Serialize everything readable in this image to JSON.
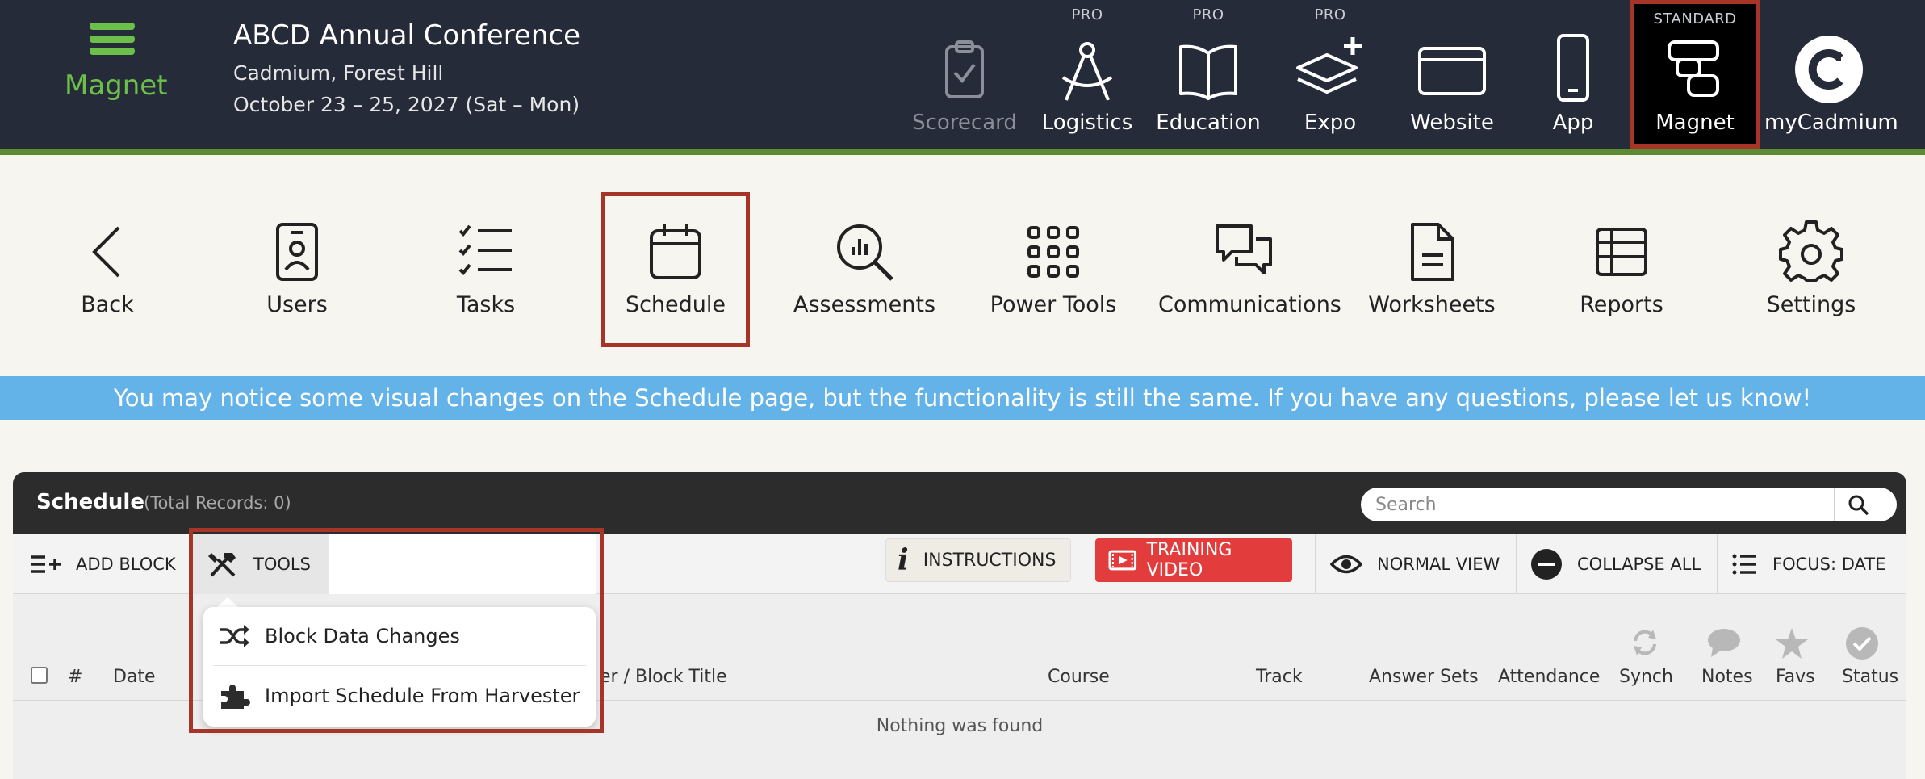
{
  "brand": {
    "name": "Magnet",
    "accent": "#6cc04a"
  },
  "conference": {
    "title": "ABCD Annual Conference",
    "venue": "Cadmium, Forest Hill",
    "dates": "October 23 – 25, 2027 (Sat – Mon)"
  },
  "app_nav": [
    {
      "label": "Scorecard",
      "tier": "",
      "icon": "clipboard-check-icon",
      "state": "disabled"
    },
    {
      "label": "Logistics",
      "tier": "PRO",
      "icon": "compass-icon",
      "state": "normal"
    },
    {
      "label": "Education",
      "tier": "PRO",
      "icon": "open-book-icon",
      "state": "normal"
    },
    {
      "label": "Expo",
      "tier": "PRO",
      "icon": "layers-plus-icon",
      "state": "normal"
    },
    {
      "label": "Website",
      "tier": "",
      "icon": "browser-window-icon",
      "state": "normal"
    },
    {
      "label": "App",
      "tier": "",
      "icon": "smartphone-icon",
      "state": "normal"
    },
    {
      "label": "Magnet",
      "tier": "STANDARD",
      "icon": "magnet-stack-icon",
      "state": "active"
    },
    {
      "label": "myCadmium",
      "tier": "",
      "icon": "cadmium-logo-icon",
      "state": "normal"
    }
  ],
  "module_nav": [
    {
      "label": "Back",
      "icon": "chevron-left-icon"
    },
    {
      "label": "Users",
      "icon": "id-badge-icon"
    },
    {
      "label": "Tasks",
      "icon": "checklist-icon"
    },
    {
      "label": "Schedule",
      "icon": "calendar-icon",
      "active": true
    },
    {
      "label": "Assessments",
      "icon": "magnifier-chart-icon"
    },
    {
      "label": "Power Tools",
      "icon": "grid-dots-icon"
    },
    {
      "label": "Communications",
      "icon": "chat-bubbles-icon"
    },
    {
      "label": "Worksheets",
      "icon": "document-icon"
    },
    {
      "label": "Reports",
      "icon": "table-icon"
    },
    {
      "label": "Settings",
      "icon": "gear-icon"
    }
  ],
  "banner": {
    "text": "You may notice some visual changes on the Schedule page, but the functionality is still the same. If you have any questions, please let us know!",
    "color": "#63b2e8"
  },
  "schedule": {
    "title": "Schedule",
    "total_records": "(Total Records: 0)",
    "search_placeholder": "Search",
    "toolbar": {
      "add_block": "ADD BLOCK",
      "tools": "TOOLS",
      "instructions": "INSTRUCTIONS",
      "training_video": "TRAINING VIDEO",
      "normal_view": "NORMAL VIEW",
      "collapse_all": "COLLAPSE ALL",
      "focus": "FOCUS: DATE"
    },
    "tools_menu": [
      {
        "label": "Block Data Changes",
        "icon": "shuffle-icon"
      },
      {
        "label": "Import Schedule From Harvester",
        "icon": "puzzle-icon"
      }
    ],
    "columns": {
      "number": "#",
      "date": "Date",
      "title_partial": "er / Block Title",
      "course": "Course",
      "track": "Track",
      "answer_sets": "Answer Sets",
      "attendance": "Attendance",
      "synch": "Synch",
      "notes": "Notes",
      "favs": "Favs",
      "status": "Status"
    },
    "empty_text": "Nothing was found"
  },
  "colors": {
    "topbar": "#252b38",
    "topbar_line": "#5d8a33",
    "highlight_frame": "#a63427",
    "training_video": "#e23c3c"
  }
}
